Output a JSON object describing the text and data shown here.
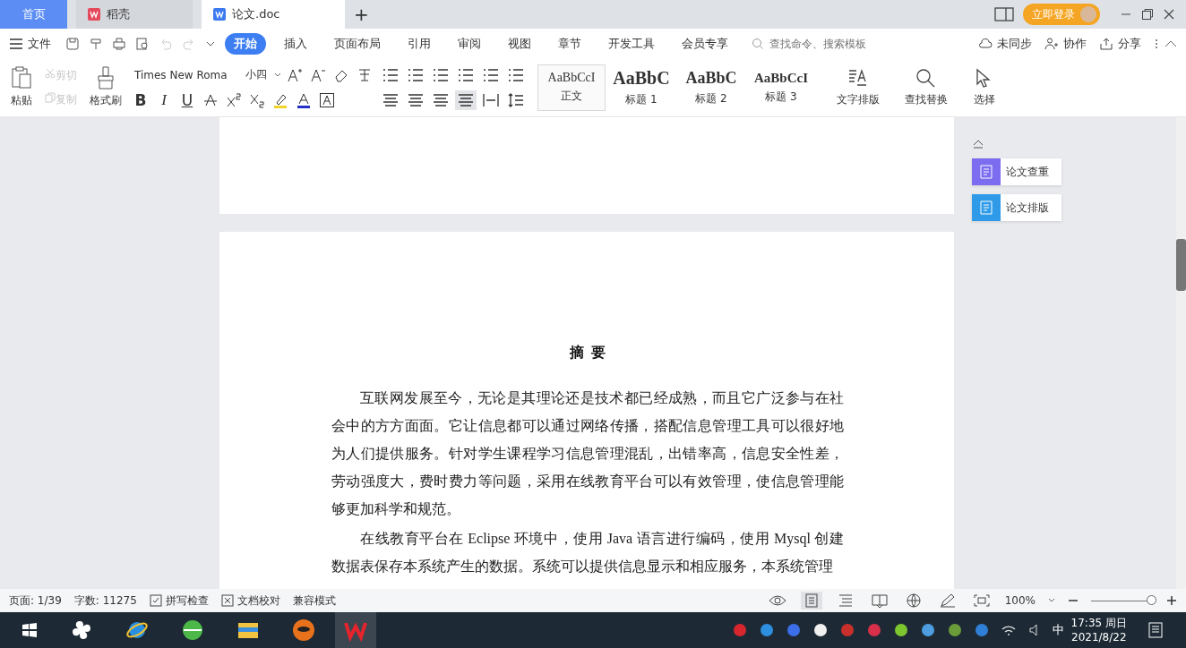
{
  "tabs": [
    {
      "label": "首页",
      "kind": "home",
      "selected": false
    },
    {
      "label": "稻壳",
      "kind": "docer",
      "selected": false
    },
    {
      "label": "论文.doc",
      "kind": "doc",
      "selected": true
    }
  ],
  "new_tab": "+",
  "login_button": "立即登录",
  "menu": {
    "file": "文件",
    "ribbon_tabs": [
      {
        "label": "开始",
        "selected": true
      },
      {
        "label": "插入",
        "selected": false
      },
      {
        "label": "页面布局",
        "selected": false
      },
      {
        "label": "引用",
        "selected": false
      },
      {
        "label": "审阅",
        "selected": false
      },
      {
        "label": "视图",
        "selected": false
      },
      {
        "label": "章节",
        "selected": false
      },
      {
        "label": "开发工具",
        "selected": false
      },
      {
        "label": "会员专享",
        "selected": false
      }
    ],
    "search": {
      "placeholder": "查找命令、搜索模板"
    },
    "actions": [
      "未同步",
      "协作",
      "分享"
    ]
  },
  "ribbon": {
    "paste": "粘贴",
    "cut": {
      "label": "剪切",
      "disabled": true
    },
    "copy": {
      "label": "复制",
      "disabled": true
    },
    "format_painter": "格式刷",
    "font_family": "Times New Roma",
    "font_size": "小四",
    "format_glyphs": [
      "B",
      "I",
      "U"
    ],
    "styles": [
      {
        "preview": "AaBbCcI",
        "label": "正文",
        "kind": "body",
        "selected": true
      },
      {
        "preview": "AaBbC",
        "label": "标题 1",
        "kind": "h1",
        "selected": false
      },
      {
        "preview": "AaBbC",
        "label": "标题 2",
        "kind": "h2",
        "selected": false
      },
      {
        "preview": "AaBbCcI",
        "label": "标题 3",
        "kind": "h3",
        "selected": false
      }
    ],
    "tools": [
      {
        "label": "文字排版",
        "kind": "layout"
      },
      {
        "label": "查找替换",
        "kind": "find"
      },
      {
        "label": "选择",
        "kind": "select"
      }
    ]
  },
  "document": {
    "heading": "摘  要",
    "paragraphs": [
      "互联网发展至今，无论是其理论还是技术都已经成熟，而且它广泛参与在社会中的方方面面。它让信息都可以通过网络传播，搭配信息管理工具可以很好地为人们提供服务。针对学生课程学习信息管理混乱，出错率高，信息安全性差，劳动强度大，费时费力等问题，采用在线教育平台可以有效管理，使信息管理能够更加科学和规范。",
      "在线教育平台在 Eclipse 环境中，使用 Java 语言进行编码，使用 Mysql 创建数据表保存本系统产生的数据。系统可以提供信息显示和相应服务，本系统管理"
    ]
  },
  "side_panel": [
    {
      "label": "论文查重",
      "color": "#7b6cf0"
    },
    {
      "label": "论文排版",
      "color": "#2f9be8"
    }
  ],
  "status_bar": {
    "page": "页面: 1/39",
    "words": "字数: 11275",
    "spell_check": "拼写检查",
    "proofread": "文档校对",
    "mode": "兼容模式",
    "zoom": "100%",
    "zoom_slider": {
      "level": 0.97
    }
  },
  "taskbar": {
    "ime": "中",
    "time": "17:35 周日",
    "date": "2021/8/22"
  }
}
